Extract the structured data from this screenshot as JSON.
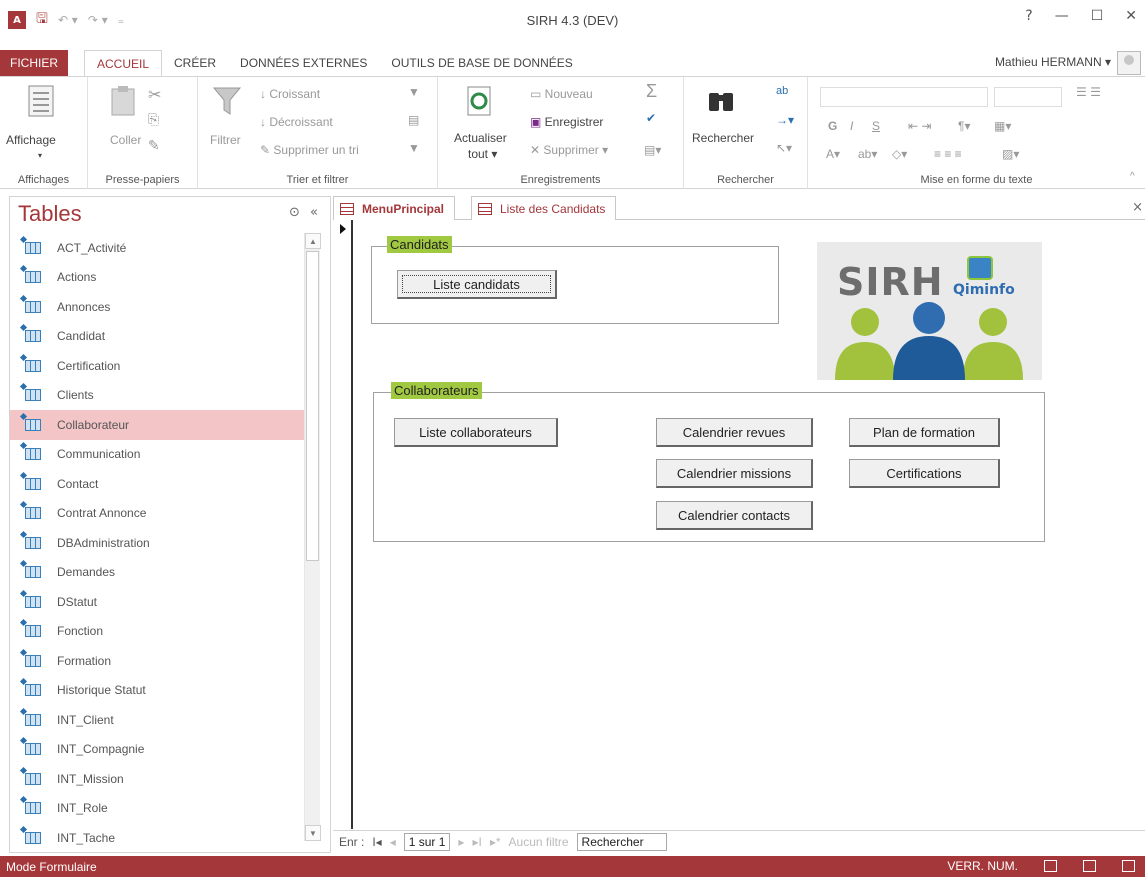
{
  "window": {
    "title": "SIRH 4.3 (DEV)",
    "help": "?",
    "minimize": "—",
    "maximize": "☐",
    "close": "✕"
  },
  "qat": {
    "app_icon": "A",
    "save": "🖫",
    "undo": "↶ ▾",
    "redo": "↷ ▾",
    "customize": "₌"
  },
  "ribbon_tabs": [
    "FICHIER",
    "ACCUEIL",
    "CRÉER",
    "DONNÉES EXTERNES",
    "OUTILS DE BASE DE DONNÉES"
  ],
  "user": {
    "name": "Mathieu HERMANN ▾"
  },
  "ribbon": {
    "affichage": {
      "button": "Affichage",
      "group": "Affichages"
    },
    "presse": {
      "coller": "Coller",
      "group": "Presse-papiers"
    },
    "trier": {
      "filtrer": "Filtrer",
      "croissant": "Croissant",
      "decroissant": "Décroissant",
      "supprimer_tri": "Supprimer un tri",
      "group": "Trier et filtrer"
    },
    "enregistrements": {
      "actualiser": "Actualiser",
      "tout": "tout ▾",
      "nouveau": "Nouveau",
      "enregistrer": "Enregistrer",
      "supprimer": "Supprimer ▾",
      "group": "Enregistrements"
    },
    "rechercher": {
      "button": "Rechercher",
      "group": "Rechercher"
    },
    "texte": {
      "group": "Mise en forme du texte",
      "bold": "G",
      "italic": "I",
      "underline": "S"
    }
  },
  "nav": {
    "title": "Tables",
    "items": [
      "ACT_Activité",
      "Actions",
      "Annonces",
      "Candidat",
      "Certification",
      "Clients",
      "Collaborateur",
      "Communication",
      "Contact",
      "Contrat Annonce",
      "DBAdministration",
      "Demandes",
      "DStatut",
      "Fonction",
      "Formation",
      "Historique Statut",
      "INT_Client",
      "INT_Compagnie",
      "INT_Mission",
      "INT_Role",
      "INT_Tache"
    ],
    "selected_index": 6
  },
  "doc_tabs": {
    "active": "MenuPrincipal",
    "other": "Liste des Candidats"
  },
  "form": {
    "candidats_label": "Candidats",
    "liste_candidats": "Liste candidats",
    "collaborateurs_label": "Collaborateurs",
    "liste_collaborateurs": "Liste collaborateurs",
    "calendrier_revues": "Calendrier revues",
    "calendrier_missions": "Calendrier missions",
    "calendrier_contacts": "Calendrier contacts",
    "plan_formation": "Plan de formation",
    "certifications": "Certifications",
    "logo_text": "SIRH",
    "logo_brand": "Qiminfo"
  },
  "record_nav": {
    "label": "Enr :",
    "first": "I◂",
    "prev": "◂",
    "position": "1 sur 1",
    "next": "▸",
    "last": "▸I",
    "new": "▸*",
    "filter": "Aucun filtre",
    "search": "Rechercher"
  },
  "status": {
    "mode": "Mode Formulaire",
    "verr_num": "VERR. NUM."
  },
  "colors": {
    "accent": "#a4373a",
    "frame_label": "#a0c840",
    "selected_row": "#f4c5c7"
  }
}
